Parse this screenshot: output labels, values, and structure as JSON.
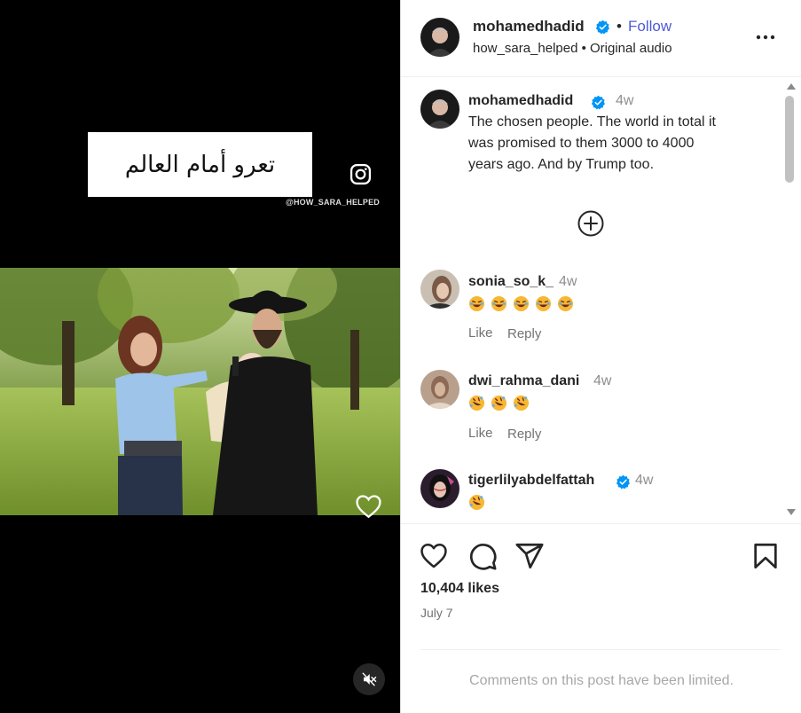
{
  "media": {
    "caption_text": "تعرو أمام العالم",
    "watermark": "@HOW_SARA_HELPED",
    "icons": [
      "instagram-icon",
      "heart-icon",
      "speaker-muted-icon"
    ]
  },
  "header": {
    "username": "mohamedhadid",
    "separator": "•",
    "follow_label": "Follow",
    "subtitle": "how_sara_helped • Original audio",
    "more_icon": "more-horizontal-icon"
  },
  "caption": {
    "username": "mohamedhadid",
    "time": "4w",
    "lines": [
      "The chosen people. The world in total it",
      "was promised to them 3000 to 4000",
      "years ago. And by Trump too."
    ]
  },
  "load_more_icon": "plus-circle-icon",
  "comments": [
    {
      "username": "sonia_so_k_",
      "time": "4w",
      "emoji": "laughing",
      "emoji_count": 5,
      "like_label": "Like",
      "reply_label": "Reply"
    },
    {
      "username": "dwi_rahma_dani",
      "time": "4w",
      "emoji": "rofl",
      "emoji_count": 3,
      "like_label": "Like",
      "reply_label": "Reply"
    },
    {
      "username": "tigerlilyabdelfattah",
      "time": "4w",
      "emoji": "rofl",
      "emoji_count": 1,
      "verified": true
    }
  ],
  "actions": {
    "icons": [
      "heart-icon",
      "comment-icon",
      "share-icon",
      "bookmark-icon"
    ],
    "likes": "10,404 likes",
    "date": "July 7",
    "limited_text": "Comments on this post have been limited."
  },
  "colors": {
    "accent": "#4f5bd5",
    "verified": "#0095f6",
    "muted_text": "#737373"
  }
}
